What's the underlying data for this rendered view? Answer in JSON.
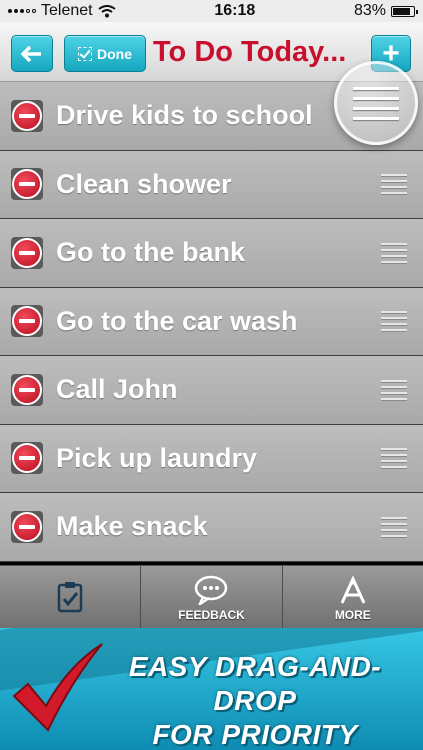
{
  "status_bar": {
    "carrier": "Telenet",
    "time": "16:18",
    "battery": "83%",
    "battery_level": 0.83
  },
  "toolbar": {
    "title": "To Do Today...",
    "done_label": "Done",
    "add_label": "+"
  },
  "tasks": [
    {
      "label": "Drive kids to school"
    },
    {
      "label": "Clean shower"
    },
    {
      "label": "Go to the bank"
    },
    {
      "label": "Go to the car wash"
    },
    {
      "label": "Call John"
    },
    {
      "label": "Pick up laundry"
    },
    {
      "label": "Make snack"
    }
  ],
  "tab_bar": {
    "tabs": [
      {
        "label": "",
        "icon": "clipboard-check-icon"
      },
      {
        "label": "FEEDBACK",
        "icon": "speech-bubble-icon"
      },
      {
        "label": "MORE",
        "icon": "app-store-icon"
      }
    ]
  },
  "promo": {
    "line1": "EASY DRAG-AND-DROP",
    "line2": "FOR PRIORITY"
  },
  "colors": {
    "accent": "#1fb5cc",
    "title": "#c8102e",
    "delete": "#d71d30"
  }
}
